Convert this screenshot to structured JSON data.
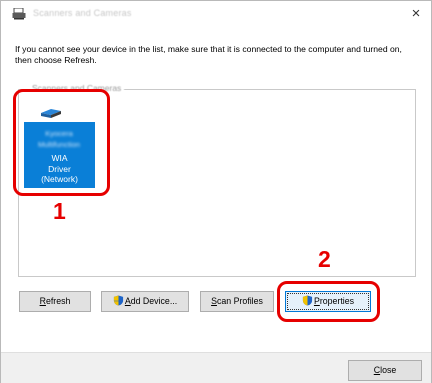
{
  "window": {
    "title": "Scanners and Cameras",
    "close_glyph": "×"
  },
  "instruction": "If you cannot see your device in the list, make sure that it is connected to the computer and turned on, then choose Refresh.",
  "group": {
    "legend": "Scanners and Cameras"
  },
  "device": {
    "icon": "scanner-icon",
    "name_blurred": "Kyocera Multifunction",
    "label": "WIA\nDriver\n(Network)"
  },
  "annotations": {
    "marker_1": "1",
    "marker_2": "2",
    "color": "#e60000"
  },
  "buttons": {
    "refresh": {
      "first": "R",
      "rest": "efresh"
    },
    "add_device": {
      "first": "A",
      "rest": "dd Device..."
    },
    "scan_profiles": {
      "first": "S",
      "rest": "can Profiles"
    },
    "properties": {
      "first": "P",
      "rest": "roperties"
    },
    "close": {
      "first": "C",
      "rest": "lose"
    }
  },
  "colors": {
    "selection": "#0a7fd7",
    "accent": "#0078d7"
  }
}
